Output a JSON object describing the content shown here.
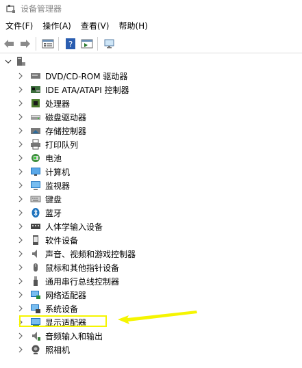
{
  "window": {
    "title": "设备管理器"
  },
  "menu": [
    "文件(F)",
    "操作(A)",
    "查看(V)",
    "帮助(H)"
  ],
  "tree": {
    "root_label": "",
    "items": [
      {
        "label": "DVD/CD-ROM 驱动器",
        "icon": "disc-drive-icon"
      },
      {
        "label": "IDE ATA/ATAPI 控制器",
        "icon": "ide-controller-icon"
      },
      {
        "label": "处理器",
        "icon": "processor-icon"
      },
      {
        "label": "磁盘驱动器",
        "icon": "disk-drive-icon"
      },
      {
        "label": "存储控制器",
        "icon": "storage-controller-icon"
      },
      {
        "label": "打印队列",
        "icon": "printer-icon"
      },
      {
        "label": "电池",
        "icon": "battery-icon"
      },
      {
        "label": "计算机",
        "icon": "computer-icon"
      },
      {
        "label": "监视器",
        "icon": "monitor-icon"
      },
      {
        "label": "键盘",
        "icon": "keyboard-icon"
      },
      {
        "label": "蓝牙",
        "icon": "bluetooth-icon"
      },
      {
        "label": "人体学输入设备",
        "icon": "hid-icon"
      },
      {
        "label": "软件设备",
        "icon": "software-device-icon"
      },
      {
        "label": "声音、视频和游戏控制器",
        "icon": "speaker-icon"
      },
      {
        "label": "鼠标和其他指针设备",
        "icon": "mouse-icon"
      },
      {
        "label": "通用串行总线控制器",
        "icon": "usb-icon"
      },
      {
        "label": "网络适配器",
        "icon": "network-adapter-icon"
      },
      {
        "label": "系统设备",
        "icon": "system-device-icon"
      },
      {
        "label": "显示适配器",
        "icon": "display-adapter-icon"
      },
      {
        "label": "音频输入和输出",
        "icon": "audio-io-icon"
      },
      {
        "label": "照相机",
        "icon": "camera-icon"
      }
    ]
  },
  "colors": {
    "annotation": "#f5f500",
    "accent_blue": "#1e73be"
  }
}
